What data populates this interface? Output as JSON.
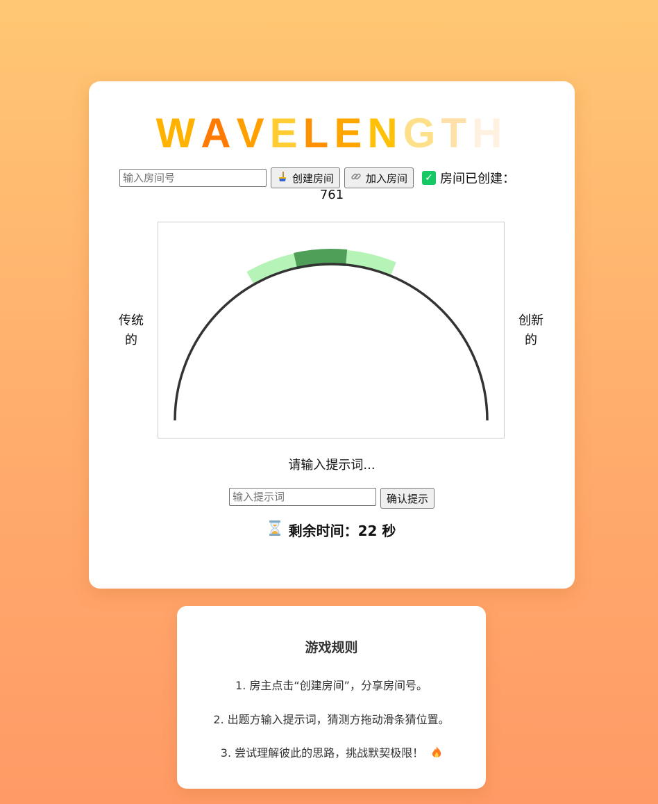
{
  "title_letters": [
    {
      "ch": "W",
      "color": "#ffb300"
    },
    {
      "ch": "A",
      "color": "#ff7a00"
    },
    {
      "ch": "V",
      "color": "#ff9f00"
    },
    {
      "ch": "E",
      "color": "#ffcc33"
    },
    {
      "ch": "L",
      "color": "#ff9100"
    },
    {
      "ch": "E",
      "color": "#ffa500"
    },
    {
      "ch": "N",
      "color": "#ffc107"
    },
    {
      "ch": "G",
      "color": "#ffe08a"
    },
    {
      "ch": "T",
      "color": "#ffe0a8"
    },
    {
      "ch": "H",
      "color": "#fff1df"
    }
  ],
  "room": {
    "input_placeholder": "输入房间号",
    "create_label": "创建房间",
    "join_label": "加入房间",
    "status_text": "房间已创建：",
    "room_number": "761"
  },
  "dial": {
    "left_label": "传统\n的",
    "right_label": "创新\n的",
    "target_fraction": 0.48,
    "colors": {
      "arc": "#333333",
      "zone_outer": "#b2f2b2",
      "zone_inner": "#4f9f59"
    }
  },
  "clue": {
    "prompt": "请输入提示词...",
    "input_placeholder": "输入提示词",
    "confirm_label": "确认提示"
  },
  "timer": {
    "label": "剩余时间：22 秒",
    "icon": "hourglass-icon"
  },
  "rules": {
    "heading": "游戏规则",
    "items": [
      "1. 房主点击“创建房间”，分享房间号。",
      "2. 出题方输入提示词，猜测方拖动滑条猜位置。",
      "3. 尝试理解彼此的思路，挑战默契极限！"
    ],
    "trailing_icon": "fire-icon"
  },
  "colors": {
    "bg_top": "#ffc773",
    "bg_bottom": "#ff9a66",
    "status_check": "#17c964"
  }
}
